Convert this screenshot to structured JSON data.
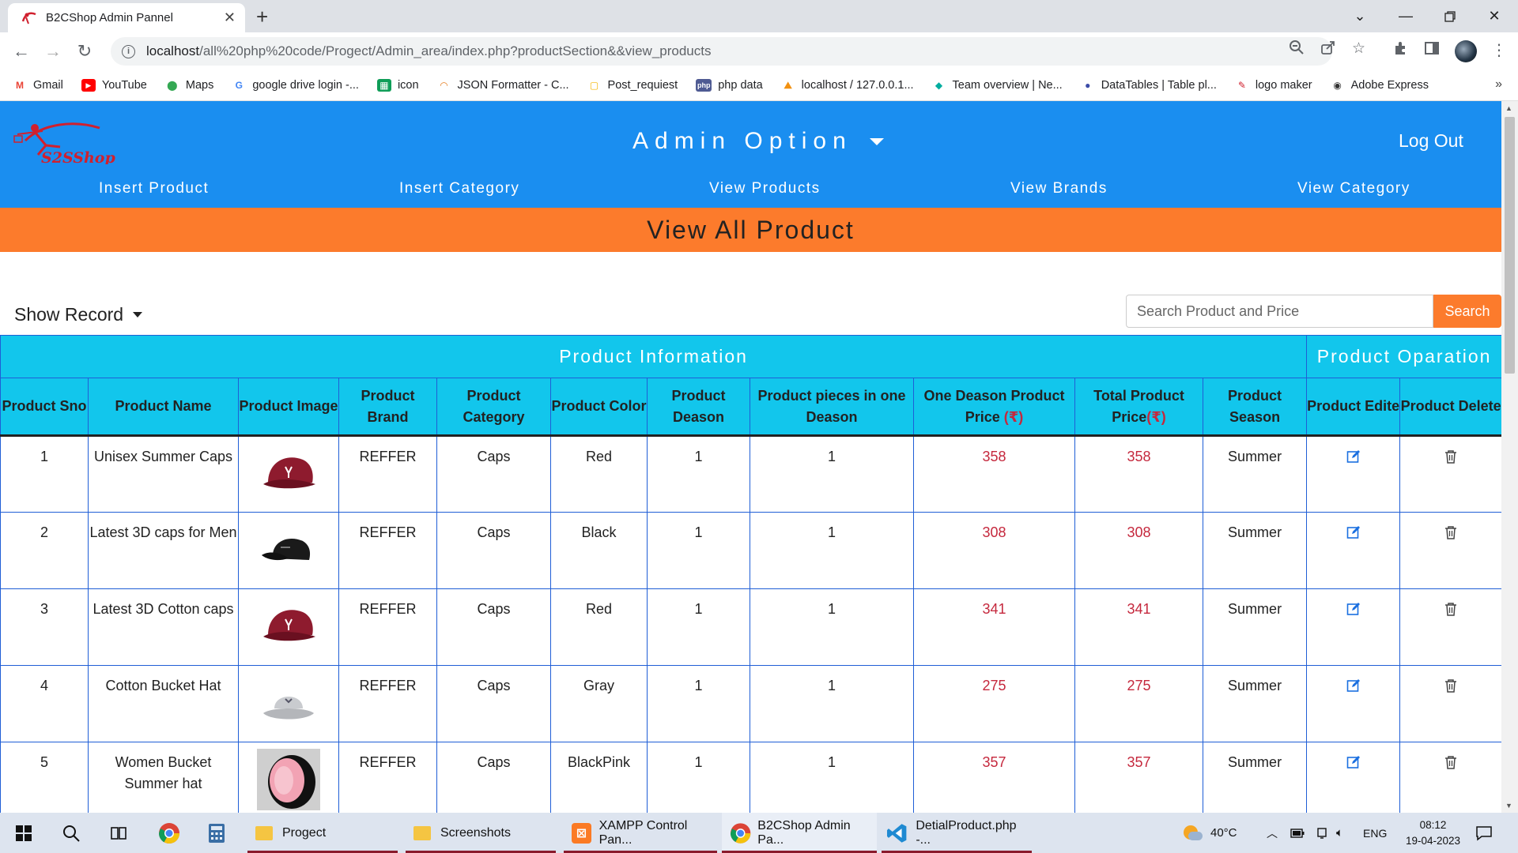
{
  "browser": {
    "tab_title": "B2CShop Admin Pannel",
    "url_host": "localhost",
    "url_path": "/all%20php%20code/Progect/Admin_area/index.php?productSection&&view_products",
    "bookmarks": [
      {
        "label": "Gmail",
        "icon": "gmail-icon",
        "color": "#ea4335"
      },
      {
        "label": "YouTube",
        "icon": "youtube-icon",
        "color": "#ff0000"
      },
      {
        "label": "Maps",
        "icon": "maps-icon",
        "color": "#34a853"
      },
      {
        "label": "google drive login -...",
        "icon": "google-icon",
        "color": "#4285f4"
      },
      {
        "label": "icon",
        "icon": "sheets-icon",
        "color": "#0f9d58"
      },
      {
        "label": "JSON Formatter - C...",
        "icon": "json-icon",
        "color": "#e67e22"
      },
      {
        "label": "Post_requiest",
        "icon": "page-icon",
        "color": "#f5b400"
      },
      {
        "label": "php data",
        "icon": "php-icon",
        "color": "#4f5b93"
      },
      {
        "label": "localhost / 127.0.0.1...",
        "icon": "phpmyadmin-icon",
        "color": "#f29111"
      },
      {
        "label": "Team overview | Ne...",
        "icon": "diamond-icon",
        "color": "#00ad9f"
      },
      {
        "label": "DataTables | Table pl...",
        "icon": "datatables-icon",
        "color": "#3c4ca8"
      },
      {
        "label": "logo maker",
        "icon": "logo-maker-icon",
        "color": "#d0202e"
      },
      {
        "label": "Adobe Express",
        "icon": "adobe-icon",
        "color": "#333333"
      }
    ]
  },
  "header": {
    "logo_text": "S2SShop",
    "admin_option": "Admin Option",
    "logout": "Log Out",
    "nav": [
      "Insert Product",
      "Insert Category",
      "View Products",
      "View Brands",
      "View Category"
    ]
  },
  "banner": "View All Product",
  "controls": {
    "show_record": "Show Record",
    "search_placeholder": "Search Product and Price",
    "search_button": "Search"
  },
  "table": {
    "group_info": "Product Information",
    "group_ops": "Product Oparation",
    "columns": {
      "sno": "Product Sno",
      "name": "Product Name",
      "image": "Product Image",
      "brand": "Product Brand",
      "category": "Product Category",
      "color": "Product Color",
      "deason": "Product Deason",
      "pieces": "Product pieces in one Deason",
      "one_price": "One Deason Product Price",
      "total_price": "Total Product Price",
      "season": "Product Season",
      "edit": "Product Edite",
      "delete": "Product Delete"
    },
    "currency": "(₹)",
    "rows": [
      {
        "sno": "1",
        "name": "Unisex Summer Caps",
        "image": "red-baseball-cap",
        "brand": "REFFER",
        "category": "Caps",
        "color": "Red",
        "deason": "1",
        "pieces": "1",
        "one_price": "358",
        "total_price": "358",
        "season": "Summer"
      },
      {
        "sno": "2",
        "name": "Latest 3D caps for Men",
        "image": "black-baseball-cap",
        "brand": "REFFER",
        "category": "Caps",
        "color": "Black",
        "deason": "1",
        "pieces": "1",
        "one_price": "308",
        "total_price": "308",
        "season": "Summer"
      },
      {
        "sno": "3",
        "name": "Latest 3D Cotton caps",
        "image": "red-baseball-cap",
        "brand": "REFFER",
        "category": "Caps",
        "color": "Red",
        "deason": "1",
        "pieces": "1",
        "one_price": "341",
        "total_price": "341",
        "season": "Summer"
      },
      {
        "sno": "4",
        "name": "Cotton Bucket Hat",
        "image": "gray-bucket-hat",
        "brand": "REFFER",
        "category": "Caps",
        "color": "Gray",
        "deason": "1",
        "pieces": "1",
        "one_price": "275",
        "total_price": "275",
        "season": "Summer"
      },
      {
        "sno": "5",
        "name": "Women Bucket Summer hat",
        "image": "pink-black-bucket-hat",
        "brand": "REFFER",
        "category": "Caps",
        "color": "BlackPink",
        "deason": "1",
        "pieces": "1",
        "one_price": "357",
        "total_price": "357",
        "season": "Summer"
      }
    ]
  },
  "taskbar": {
    "apps": [
      "Progect",
      "Screenshots",
      "XAMPP Control Pan...",
      "B2CShop Admin Pa...",
      "DetialProduct.php -..."
    ],
    "temperature": "40°C",
    "language": "ENG",
    "time": "08:12",
    "date": "19-04-2023"
  },
  "colors": {
    "header_blue": "#1a8ef0",
    "banner_orange": "#fc7b2c",
    "table_cyan": "#12c6ec",
    "price_red": "#c5283d"
  }
}
